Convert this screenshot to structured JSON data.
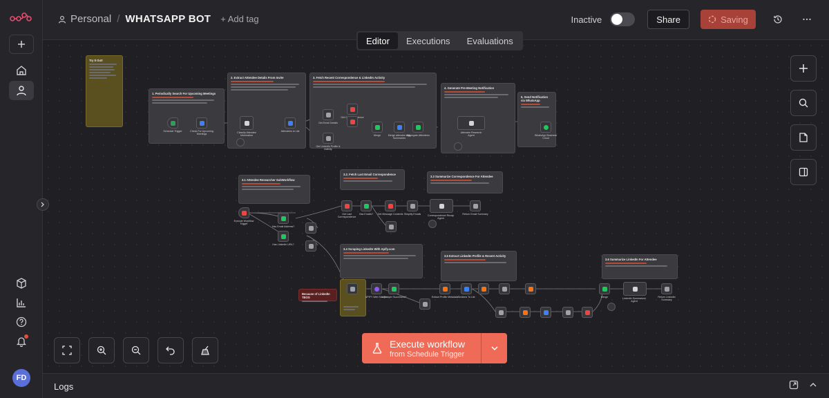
{
  "header": {
    "project": "Personal",
    "separator": "/",
    "workflow_name": "WHATSAPP BOT",
    "add_tag": "+ Add tag",
    "status_label": "Inactive",
    "share_label": "Share",
    "saving_label": "Saving"
  },
  "tabs": [
    {
      "label": "Editor",
      "active": true
    },
    {
      "label": "Executions",
      "active": false
    },
    {
      "label": "Evaluations",
      "active": false
    }
  ],
  "execute": {
    "label": "Execute workflow",
    "sublabel": "from Schedule Trigger"
  },
  "logs": {
    "label": "Logs"
  },
  "user": {
    "initials": "FD"
  },
  "colors": {
    "accent": "#ef6a57",
    "saving_bg": "#a84238",
    "avatar": "#5b6fd9",
    "sticky_yellow": "#5a4f1e",
    "sticky_red": "#5a2020"
  },
  "canvas": {
    "stickies": [
      {
        "title": "Try It Out!"
      },
      {
        "title": "1. Periodically Search For Upcoming Meetings"
      },
      {
        "title": "2. Extract Attendee Details From Invite"
      },
      {
        "title": "3. Fetch Recent Correspondence & LinkedIn Activity"
      },
      {
        "title": "4. Generate Pre-Meeting Notification"
      },
      {
        "title": "5. Send Notification via WhatsApp"
      },
      {
        "title": "3.1 Attendee Researcher SubWorkflow"
      },
      {
        "title": "3.2. Fetch Last Email Correspondence"
      },
      {
        "title": "3.3 Summarize Correspondence For Attendee"
      },
      {
        "title": "3.4 Scraping LinkedIn With Apify.com"
      },
      {
        "title": "3.5 Extract LinkedIn Profile & Recent Activity"
      },
      {
        "title": "3.6 Summarize LinkedIn For Attendee"
      },
      {
        "title": "Because of LinkedIn TBOS"
      }
    ],
    "nodes": [
      {
        "label": "Schedule Trigger"
      },
      {
        "label": "Check For Upcoming Meetings"
      },
      {
        "label": "Classify Attendee Information"
      },
      {
        "label": "Attendees to List"
      },
      {
        "label": "Get Email Details"
      },
      {
        "label": "Get Correspondence"
      },
      {
        "label": "Get LinkedIn Profile & Activity"
      },
      {
        "label": "Merge"
      },
      {
        "label": "Merge attendee with Summaries"
      },
      {
        "label": "Aggregate Attendees"
      },
      {
        "label": "Attendee Research Agent"
      },
      {
        "label": "WhatsApp Business Cloud"
      },
      {
        "label": "Execute Workflow Trigger"
      },
      {
        "label": "Has Email Address?"
      },
      {
        "label": "Has LinkedIn URL?"
      },
      {
        "label": "Get Last Correspondence"
      },
      {
        "label": "Has Emails?"
      },
      {
        "label": "Get Message Contents"
      },
      {
        "label": "Simplify Emails"
      },
      {
        "label": "Correspondence Recap Agent"
      },
      {
        "label": "Return Email Summary"
      },
      {
        "label": "APIFY Web Scraper"
      },
      {
        "label": "Is Scraper Successful?"
      },
      {
        "label": "Extract Profile Metadata"
      },
      {
        "label": "Sections To List"
      },
      {
        "label": "Merge"
      },
      {
        "label": "LinkedIn Summarizer Agent"
      },
      {
        "label": "Return LinkedIn Summary"
      }
    ]
  }
}
